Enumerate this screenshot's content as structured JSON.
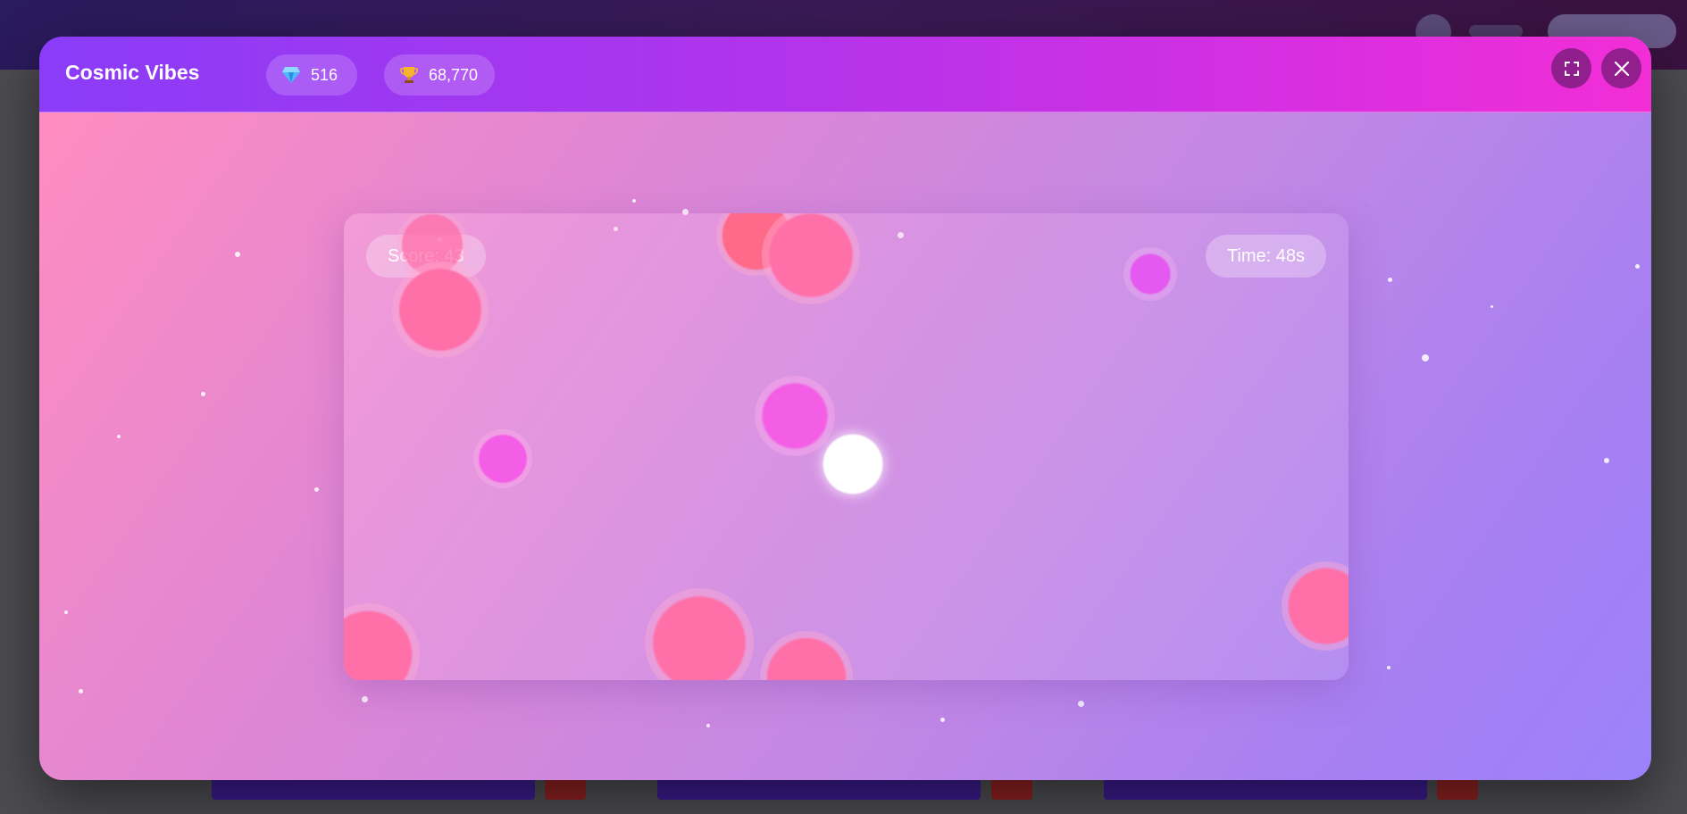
{
  "game": {
    "title": "Cosmic Vibes",
    "gems": "516",
    "trophies": "68,770",
    "hud": {
      "score_label": "Score: 43",
      "time_label": "Time: 48s"
    },
    "controls": {
      "fullscreen_icon": "fullscreen-icon",
      "close_icon": "close-icon"
    },
    "icons": {
      "gems": "gem-icon",
      "trophies": "trophy-icon"
    }
  },
  "colors": {
    "header_start": "#8a3cf8",
    "header_end": "#f22ed6",
    "orb_pink": "#ff6fa8",
    "orb_magenta": "#f45ee6",
    "player": "#ffffff"
  }
}
